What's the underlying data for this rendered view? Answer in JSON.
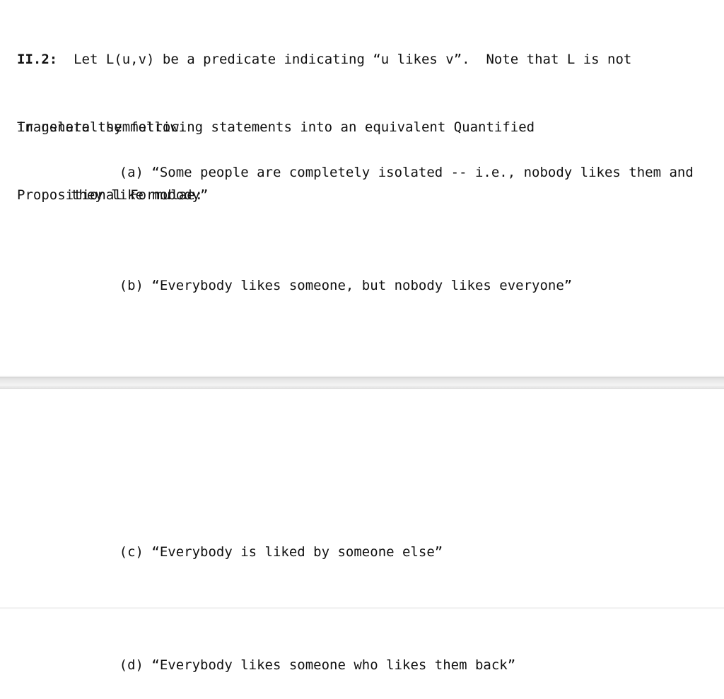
{
  "document": {
    "background_color": "#ffffff",
    "text_color": "#111111",
    "separator_color": "#dcdcdc"
  },
  "intro": {
    "label": "II.2:",
    "line1": "  Let L(u,v) be a predicate indicating “u likes v”.  Note that L is not",
    "line2": "in general symmetric."
  },
  "instruction": {
    "line1": "Translate the following statements into an equivalent Quantified",
    "line2": "Propositional Formulae:"
  },
  "items_upper": [
    {
      "marker": "(a)",
      "text": "(a) “Some people are completely isolated -- i.e., nobody likes them and they like nobody”"
    },
    {
      "marker": "(b)",
      "text": "(b) “Everybody likes someone, but nobody likes everyone”"
    }
  ],
  "items_lower": [
    {
      "marker": "(c)",
      "text": "(c) “Everybody is liked by someone else”"
    },
    {
      "marker": "(d)",
      "text": "(d) “Everybody likes someone who likes them back”"
    }
  ]
}
